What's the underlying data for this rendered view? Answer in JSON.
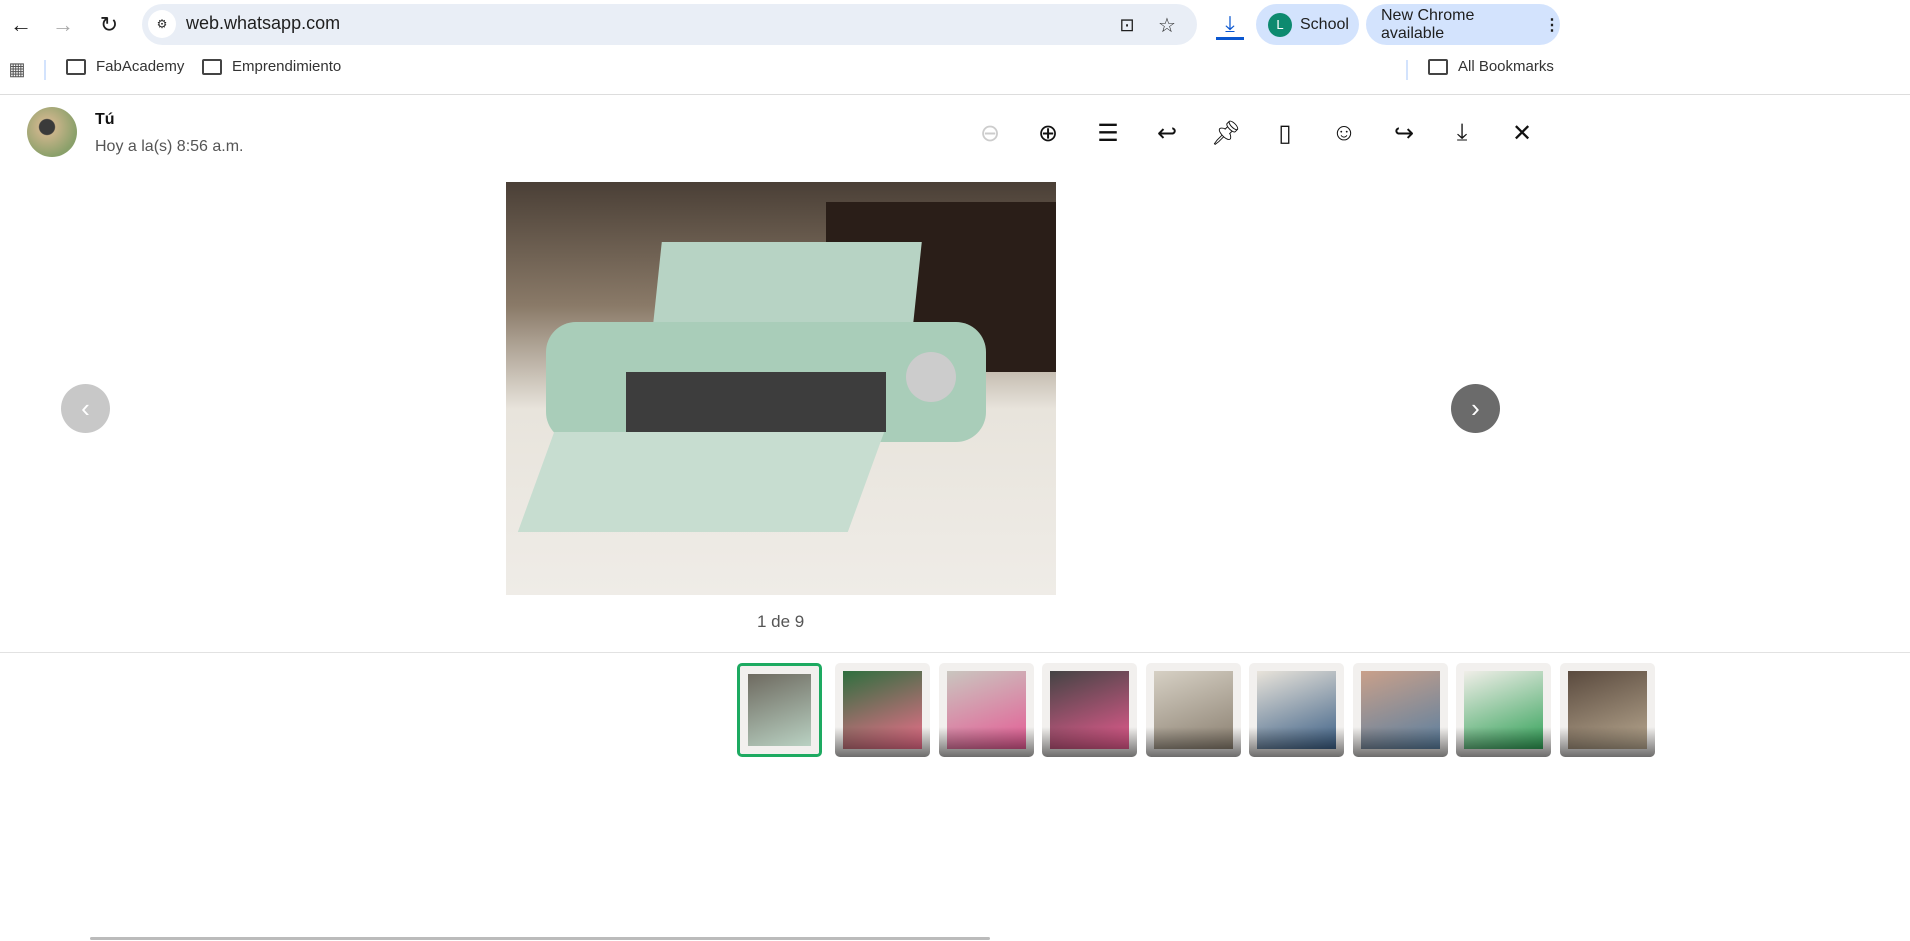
{
  "browser": {
    "url": "web.whatsapp.com",
    "profile_initial": "L",
    "profile_name": "School",
    "update_label": "New Chrome available",
    "bookmarks": [
      "FabAcademy",
      "Emprendimiento"
    ],
    "all_bookmarks": "All Bookmarks",
    "accent": "#0b57d0"
  },
  "viewer": {
    "sender": "Tú",
    "timestamp": "Hoy a la(s) 8:56 a.m.",
    "counter": "1 de 9",
    "tools": [
      "zoom-out-icon",
      "zoom-in-icon",
      "caption-icon",
      "reply-icon",
      "pin-icon",
      "bookmark-icon",
      "emoji-icon",
      "forward-icon",
      "download-icon",
      "close-icon"
    ],
    "selected_thumb_color": "#1daa61",
    "thumbnails": [
      {
        "colors": [
          "#6e6a60",
          "#b9d1c2"
        ]
      },
      {
        "colors": [
          "#2e6f3e",
          "#f06d8c"
        ]
      },
      {
        "colors": [
          "#c9c6bf",
          "#e55a94"
        ]
      },
      {
        "colors": [
          "#444",
          "#e75b8f"
        ]
      },
      {
        "colors": [
          "#d6d0c4",
          "#8a7f70"
        ]
      },
      {
        "colors": [
          "#e8e3da",
          "#3b5f86"
        ]
      },
      {
        "colors": [
          "#c9a08a",
          "#5a7fa0"
        ]
      },
      {
        "colors": [
          "#f0eee8",
          "#2fa056"
        ]
      },
      {
        "colors": [
          "#5a4a3e",
          "#b8a890"
        ]
      }
    ]
  }
}
